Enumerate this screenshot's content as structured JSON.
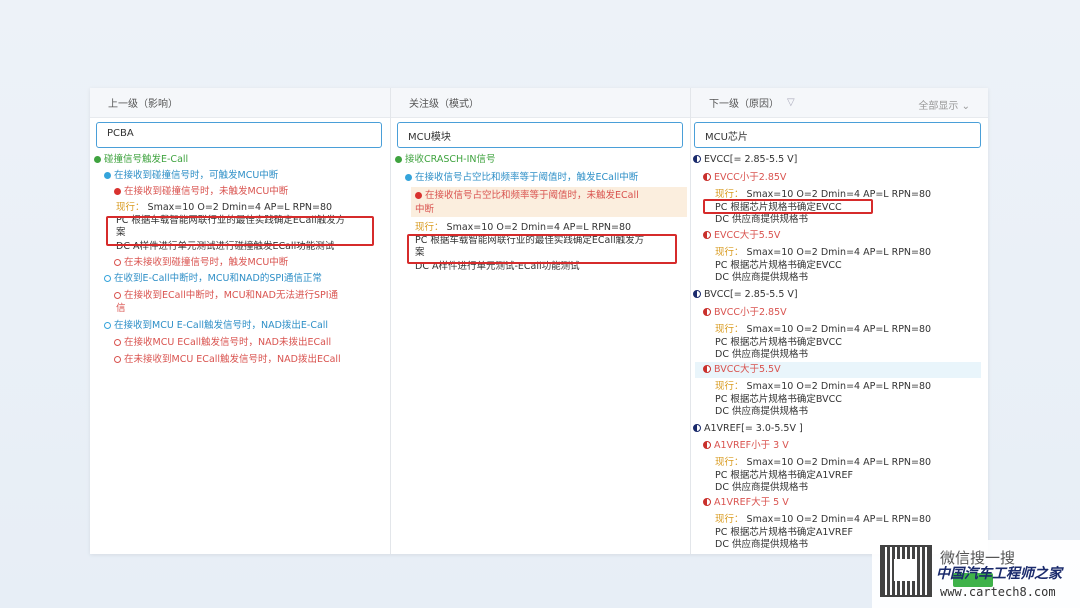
{
  "columns": {
    "upper": {
      "header": "上一级（影响）",
      "search_value": "PCBA",
      "items": [
        "碰撞信号触发E-Call",
        "在接收到碰撞信号时，可触发MCU中断",
        "在接收到碰撞信号时，未触发MCU中断",
        "现行：",
        "Smax=10 O=2 Dmin=4 AP=L RPN=80",
        "PC 根据车载智能网联行业的最佳实践确定ECall触发方",
        "案",
        "DC A样件进行单元测试进行碰撞触发ECall功能测试",
        "在未接收到碰撞信号时，触发MCU中断",
        "在收到E-Call中断时，MCU和NAD的SPI通信正常",
        "在接收到ECall中断时，MCU和NAD无法进行SPI通",
        "信",
        "在接收到MCU E-Call触发信号时，NAD拨出E-Call",
        "在接收MCU ECall触发信号时，NAD未拨出ECall",
        "在未接收到MCU ECall触发信号时，NAD拨出ECall"
      ]
    },
    "focus": {
      "header": "关注级（模式）",
      "search_value": "MCU模块",
      "items": [
        "接收CRASCH-IN信号",
        "在接收信号占空比和频率等于阈值时，触发ECall中断",
        "在接收信号占空比和频率等于阈值时，未触发ECall",
        "中断",
        "现行：",
        "Smax=10 O=2 Dmin=4 AP=L RPN=80",
        "PC 根据车载智能网联行业的最佳实践确定ECall触发方",
        "案",
        "DC A样件进行单元测试-ECall功能测试"
      ]
    },
    "lower": {
      "header": "下一级（原因）",
      "show_all": "全部显示",
      "search_value": "MCU芯片",
      "groups": [
        {
          "title": "EVCC[= 2.85-5.5 V]",
          "causes": [
            {
              "name": "EVCC小于2.85V",
              "current": "现行：",
              "rating": "Smax=10 O=2 Dmin=4 AP=L RPN=80",
              "pc": "PC 根据芯片规格书确定EVCC",
              "dc": "DC 供应商提供规格书"
            },
            {
              "name": "EVCC大于5.5V",
              "current": "现行：",
              "rating": "Smax=10 O=2 Dmin=4 AP=L RPN=80",
              "pc": "PC 根据芯片规格书确定EVCC",
              "dc": "DC 供应商提供规格书"
            }
          ]
        },
        {
          "title": "BVCC[= 2.85-5.5 V]",
          "causes": [
            {
              "name": "BVCC小于2.85V",
              "current": "现行：",
              "rating": "Smax=10 O=2 Dmin=4 AP=L RPN=80",
              "pc": "PC 根据芯片规格书确定BVCC",
              "dc": "DC 供应商提供规格书"
            },
            {
              "name": "BVCC大于5.5V",
              "current": "现行：",
              "rating": "Smax=10 O=2 Dmin=4 AP=L RPN=80",
              "pc": "PC 根据芯片规格书确定BVCC",
              "dc": "DC 供应商提供规格书"
            }
          ]
        },
        {
          "title": "A1VREF[= 3.0-5.5V ]",
          "causes": [
            {
              "name": "A1VREF小于 3 V",
              "current": "现行：",
              "rating": "Smax=10 O=2 Dmin=4 AP=L RPN=80",
              "pc": "PC 根据芯片规格书确定A1VREF",
              "dc": "DC 供应商提供规格书"
            },
            {
              "name": "A1VREF大于 5 V",
              "current": "现行：",
              "rating": "Smax=10 O=2 Dmin=4 AP=L RPN=80",
              "pc": "PC 根据芯片规格书确定A1VREF",
              "dc": "DC 供应商提供规格书"
            }
          ]
        }
      ]
    }
  },
  "watermark": {
    "search_text": "微信搜一搜",
    "brand": "中国汽车工程师之家",
    "url": "www.cartech8.com"
  }
}
